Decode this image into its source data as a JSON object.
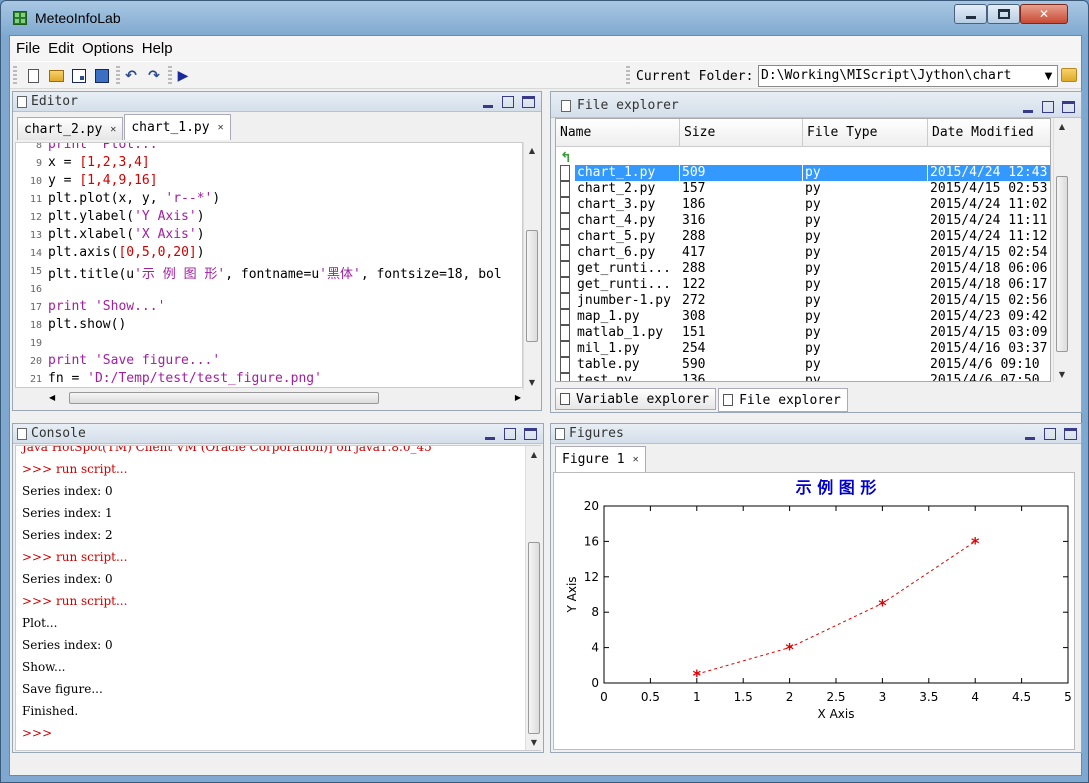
{
  "window": {
    "title": "MeteoInfoLab"
  },
  "menu": [
    "File",
    "Edit",
    "Options",
    "Help"
  ],
  "toolbar": {
    "current_folder_label": "Current Folder:",
    "current_folder_value": "D:\\Working\\MIScript\\Jython\\chart"
  },
  "editor": {
    "title": "Editor",
    "tabs": [
      {
        "label": "chart_2.py",
        "active": false
      },
      {
        "label": "chart_1.py",
        "active": true
      }
    ],
    "lines": [
      {
        "n": "8",
        "segs": [
          [
            "kw",
            "print "
          ],
          [
            "st",
            "'Plot...'"
          ]
        ]
      },
      {
        "n": "9",
        "segs": [
          [
            "p",
            "x = "
          ],
          [
            "nm",
            "[1,2,3,4]"
          ]
        ]
      },
      {
        "n": "10",
        "segs": [
          [
            "p",
            "y = "
          ],
          [
            "nm",
            "[1,4,9,16]"
          ]
        ]
      },
      {
        "n": "11",
        "segs": [
          [
            "p",
            "plt.plot(x, y, "
          ],
          [
            "st",
            "'r--*'"
          ],
          [
            "p",
            ")"
          ]
        ]
      },
      {
        "n": "12",
        "segs": [
          [
            "p",
            "plt.ylabel("
          ],
          [
            "st",
            "'Y Axis'"
          ],
          [
            "p",
            ")"
          ]
        ]
      },
      {
        "n": "13",
        "segs": [
          [
            "p",
            "plt.xlabel("
          ],
          [
            "st",
            "'X Axis'"
          ],
          [
            "p",
            ")"
          ]
        ]
      },
      {
        "n": "14",
        "segs": [
          [
            "p",
            "plt.axis("
          ],
          [
            "nm",
            "[0,5,0,20]"
          ],
          [
            "p",
            ")"
          ]
        ]
      },
      {
        "n": "15",
        "segs": [
          [
            "p",
            "plt.title(u"
          ],
          [
            "st",
            "'示 例 图 形'"
          ],
          [
            "p",
            ", fontname=u"
          ],
          [
            "st",
            "'黑体'"
          ],
          [
            "p",
            ", fontsize=18, bol"
          ]
        ]
      },
      {
        "n": "16",
        "segs": []
      },
      {
        "n": "17",
        "segs": [
          [
            "kw",
            "print "
          ],
          [
            "st",
            "'Show...'"
          ]
        ]
      },
      {
        "n": "18",
        "segs": [
          [
            "p",
            "plt.show()"
          ]
        ]
      },
      {
        "n": "19",
        "segs": []
      },
      {
        "n": "20",
        "segs": [
          [
            "kw",
            "print "
          ],
          [
            "st",
            "'Save figure...'"
          ]
        ]
      },
      {
        "n": "21",
        "segs": [
          [
            "p",
            "fn = "
          ],
          [
            "st",
            "'D:/Temp/test/test_figure.png'"
          ]
        ]
      }
    ]
  },
  "file_explorer": {
    "title": "File explorer",
    "columns": [
      "Name",
      "Size",
      "File Type",
      "Date Modified"
    ],
    "rows": [
      {
        "name": "chart_1.py",
        "size": "509",
        "type": "py",
        "date": "2015/4/24 12:43",
        "selected": true
      },
      {
        "name": "chart_2.py",
        "size": "157",
        "type": "py",
        "date": "2015/4/15 02:53"
      },
      {
        "name": "chart_3.py",
        "size": "186",
        "type": "py",
        "date": "2015/4/24 11:02"
      },
      {
        "name": "chart_4.py",
        "size": "316",
        "type": "py",
        "date": "2015/4/24 11:11"
      },
      {
        "name": "chart_5.py",
        "size": "288",
        "type": "py",
        "date": "2015/4/24 11:12"
      },
      {
        "name": "chart_6.py",
        "size": "417",
        "type": "py",
        "date": "2015/4/15 02:54"
      },
      {
        "name": "get_runti...",
        "size": "288",
        "type": "py",
        "date": "2015/4/18 06:06"
      },
      {
        "name": "get_runti...",
        "size": "122",
        "type": "py",
        "date": "2015/4/18 06:17"
      },
      {
        "name": "jnumber-1.py",
        "size": "272",
        "type": "py",
        "date": "2015/4/15 02:56"
      },
      {
        "name": "map_1.py",
        "size": "308",
        "type": "py",
        "date": "2015/4/23 09:42"
      },
      {
        "name": "matlab_1.py",
        "size": "151",
        "type": "py",
        "date": "2015/4/15 03:09"
      },
      {
        "name": "mil_1.py",
        "size": "254",
        "type": "py",
        "date": "2015/4/16 03:37"
      },
      {
        "name": "table.py",
        "size": "590",
        "type": "py",
        "date": "2015/4/6 09:10"
      },
      {
        "name": "test.py",
        "size": "136",
        "type": "py",
        "date": "2015/4/6 07:50"
      }
    ],
    "bottom_tabs": [
      {
        "label": "Variable explorer",
        "active": false
      },
      {
        "label": "File explorer",
        "active": true
      }
    ]
  },
  "console": {
    "title": "Console",
    "lines": [
      {
        "t": "Java HotSpot(TM) Client VM (Oracle Corporation)] on java1.8.0_45",
        "p": true
      },
      {
        "t": ">>> run script...",
        "p": true
      },
      {
        "t": "Series index: 0",
        "p": false
      },
      {
        "t": "Series index: 1",
        "p": false
      },
      {
        "t": "Series index: 2",
        "p": false
      },
      {
        "t": ">>> run script...",
        "p": true
      },
      {
        "t": "Series index: 0",
        "p": false
      },
      {
        "t": ">>> run script...",
        "p": true
      },
      {
        "t": "Plot...",
        "p": false
      },
      {
        "t": "Series index: 0",
        "p": false
      },
      {
        "t": "Show...",
        "p": false
      },
      {
        "t": "Save figure...",
        "p": false
      },
      {
        "t": "Finished.",
        "p": false
      },
      {
        "t": ">>>",
        "p": true
      }
    ]
  },
  "figures": {
    "title": "Figures",
    "tabs": [
      {
        "label": "Figure 1",
        "active": true
      }
    ]
  },
  "chart_data": {
    "type": "line",
    "title": "示 例 图 形",
    "xlabel": "X Axis",
    "ylabel": "Y Axis",
    "xlim": [
      0,
      5
    ],
    "ylim": [
      0,
      20
    ],
    "xticks": [
      "0",
      "0.5",
      "1",
      "1.5",
      "2",
      "2.5",
      "3",
      "3.5",
      "4",
      "4.5",
      "5"
    ],
    "yticks": [
      "0",
      "4",
      "8",
      "12",
      "16",
      "20"
    ],
    "series": [
      {
        "x": [
          1,
          2,
          3,
          4
        ],
        "y": [
          1,
          4,
          9,
          16
        ],
        "color": "#e00000",
        "linestyle": "dashed",
        "marker": "*"
      }
    ],
    "title_color": "#0000cc",
    "grid": false
  }
}
